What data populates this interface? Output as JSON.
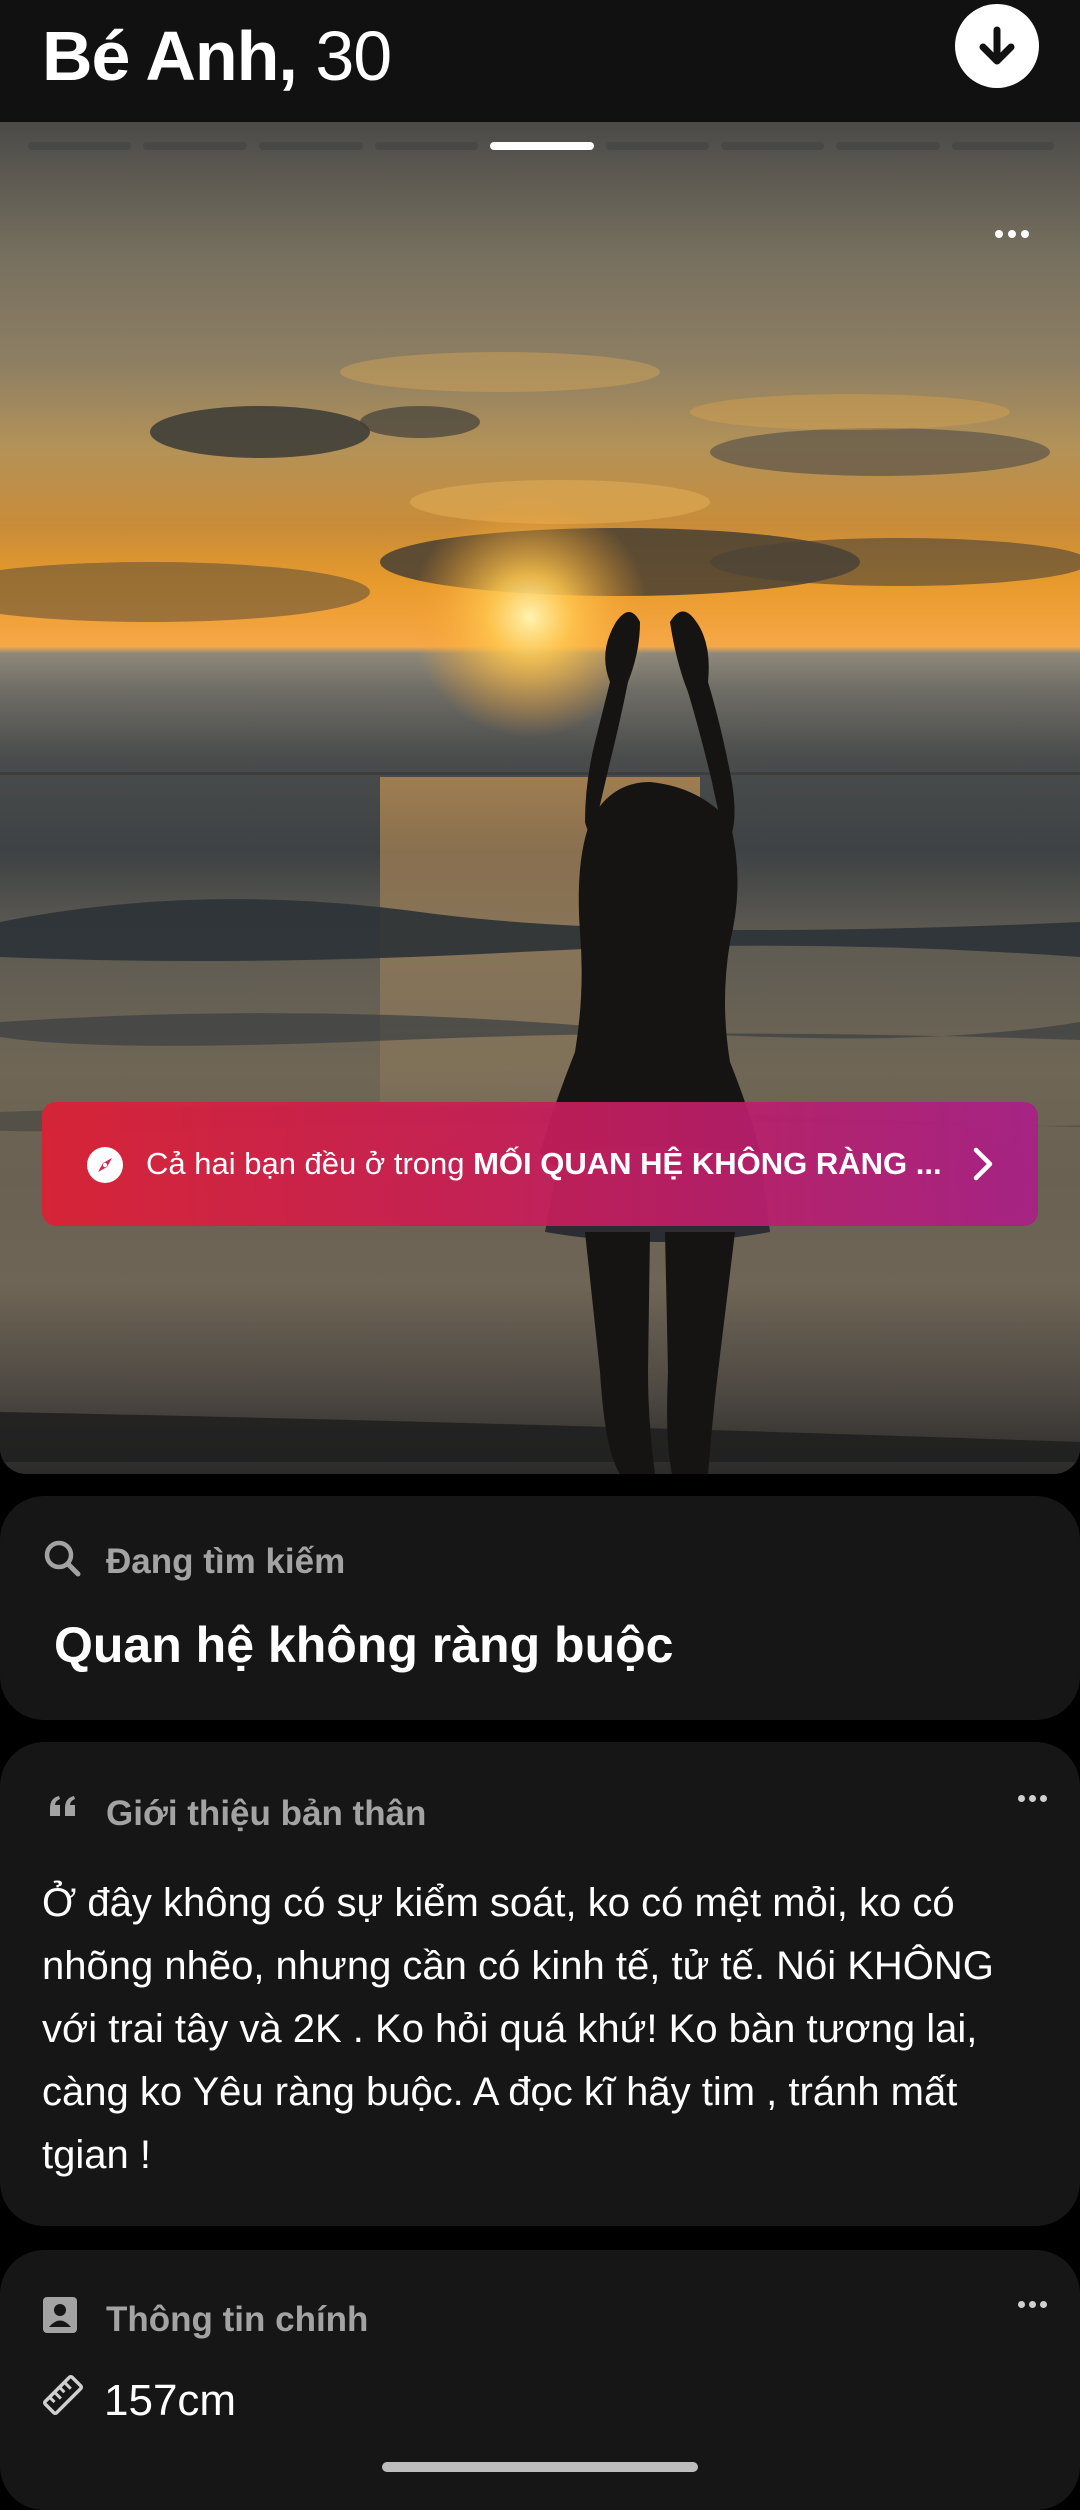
{
  "profile": {
    "name": "Bé Anh,",
    "age": "30"
  },
  "photo": {
    "total_photos": 9,
    "current_photo_index": 5,
    "alt_subject": "silhouette-at-sunset-beach"
  },
  "relationship_banner": {
    "prefix": "Cả hai bạn đều ở trong ",
    "highlight": "MỐI QUAN HỆ KHÔNG RÀNG ..."
  },
  "looking_for": {
    "label": "Đang tìm kiếm",
    "value": "Quan hệ không ràng buộc"
  },
  "bio": {
    "label": "Giới thiệu bản thân",
    "text": "Ở đây không có sự kiểm soát, ko có mệt mỏi, ko có nhõng nhẽo, nhưng cần có kinh tế, tử tế. Nói KHÔNG với trai tây và 2K . Ko hỏi quá khứ! Ko bàn tương lai, càng ko Yêu ràng buộc. A đọc kĩ hãy tim , tránh mất tgian !"
  },
  "key_info": {
    "label": "Thông tin chính",
    "height": "157cm"
  },
  "icons": {
    "download": "arrow-down-icon",
    "more": "more-horizontal-icon",
    "compass": "compass-icon",
    "chevron": "chevron-right-icon",
    "search": "search-icon",
    "quote": "quote-icon",
    "id_card": "profile-card-icon",
    "ruler": "ruler-icon"
  },
  "colors": {
    "background": "#000000",
    "card_background": "#161616",
    "banner_gradient_start": "#da2236",
    "banner_gradient_end": "#aa1e87",
    "muted_label": "#a3a3a3"
  }
}
